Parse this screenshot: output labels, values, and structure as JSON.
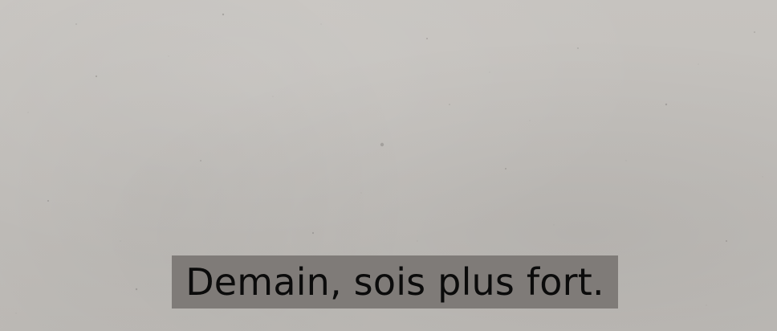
{
  "subtitle": {
    "text": "Demain, sois plus fort."
  },
  "colors": {
    "background": "#c3c0bc",
    "subtitle_bar": "#7f7b78",
    "subtitle_text": "#0b0b0b"
  }
}
